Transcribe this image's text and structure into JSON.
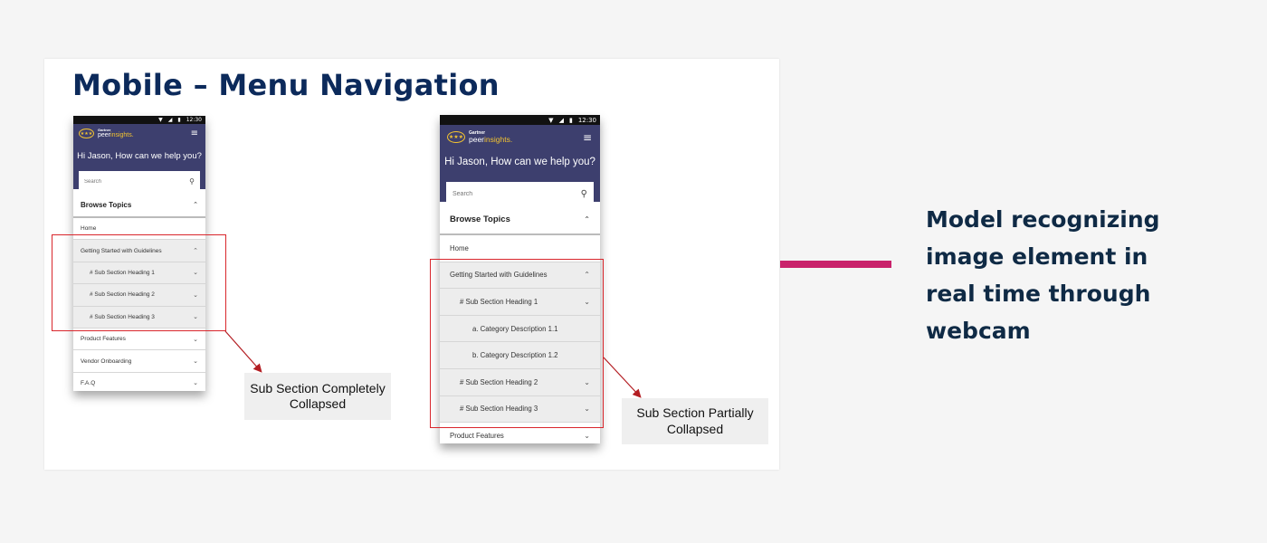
{
  "slide": {
    "title": "Mobile – Menu Navigation"
  },
  "phone_status": {
    "wifi": "▼",
    "signal": "◢",
    "battery": "▮",
    "time": "12:30"
  },
  "header": {
    "logo_small": "Gartner",
    "logo_peer": "peer",
    "logo_insights": "insights.",
    "logo_stars": "★★★",
    "greeting": "Hi Jason, How can we help you?",
    "search_placeholder": "Search"
  },
  "phone1": {
    "browse_topics": "Browse Topics",
    "items": [
      {
        "label": "Home"
      },
      {
        "label": "Getting Started with Guidelines"
      },
      {
        "label": "# Sub Section Heading 1"
      },
      {
        "label": "# Sub Section Heading 2"
      },
      {
        "label": "# Sub Section Heading 3"
      },
      {
        "label": "Product Features"
      },
      {
        "label": "Vendor Onboarding"
      },
      {
        "label": "F.A.Q"
      }
    ]
  },
  "phone2": {
    "browse_topics": "Browse Topics",
    "items": [
      {
        "label": "Home"
      },
      {
        "label": "Getting Started with Guidelines"
      },
      {
        "label": "# Sub Section Heading 1"
      },
      {
        "label": "a. Category Description 1.1"
      },
      {
        "label": "b. Category Description 1.2"
      },
      {
        "label": "# Sub Section Heading 2"
      },
      {
        "label": "# Sub Section Heading 3"
      },
      {
        "label": "Product Features"
      }
    ]
  },
  "callouts": {
    "collapsed": "Sub Section Completely Collapsed",
    "partial": "Sub Section Partially Collapsed"
  },
  "side_caption": "Model recognizing image element in real time through webcam",
  "colors": {
    "title": "#0c2a5b",
    "header_bg": "#3d3f6e",
    "accent_connector": "#c9226b",
    "highlight": "#d9262c",
    "logo_gold": "#f4c430"
  },
  "icons": {
    "chevron_up": "⌃",
    "chevron_down": "⌄",
    "menu": "≡",
    "search": "⚲"
  }
}
